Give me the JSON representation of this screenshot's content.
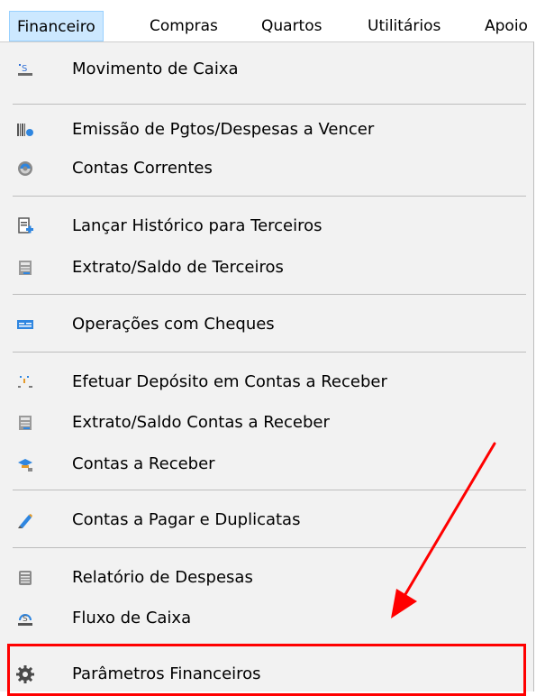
{
  "menubar": {
    "items": [
      "Financeiro",
      "Compras",
      "Quartos",
      "Utilitários",
      "Apoio"
    ],
    "active_index": 0
  },
  "menu": {
    "items": [
      {
        "label": "Movimento de Caixa",
        "icon": "cash-movement-icon"
      },
      {
        "label": "Emissão de Pgtos/Despesas a Vencer",
        "icon": "barcode-payment-icon"
      },
      {
        "label": "Contas Correntes",
        "icon": "current-accounts-icon"
      },
      {
        "label": "Lançar Histórico para Terceiros",
        "icon": "document-add-icon"
      },
      {
        "label": "Extrato/Saldo de Terceiros",
        "icon": "statement-icon"
      },
      {
        "label": "Operações com Cheques",
        "icon": "cheque-icon"
      },
      {
        "label": "Efetuar Depósito em Contas a Receber",
        "icon": "deposit-icon"
      },
      {
        "label": "Extrato/Saldo Contas a Receber",
        "icon": "statement-icon"
      },
      {
        "label": "Contas a Receber",
        "icon": "receivables-icon"
      },
      {
        "label": "Contas a Pagar e Duplicatas",
        "icon": "pen-icon"
      },
      {
        "label": "Relatório de Despesas",
        "icon": "expense-report-icon"
      },
      {
        "label": "Fluxo de Caixa",
        "icon": "cash-flow-icon"
      },
      {
        "label": "Parâmetros Financeiros",
        "icon": "gear-icon"
      }
    ]
  },
  "colors": {
    "menubar_active_bg": "#cce8ff",
    "menu_bg": "#f2f2f2",
    "annotation": "#ff0000"
  }
}
